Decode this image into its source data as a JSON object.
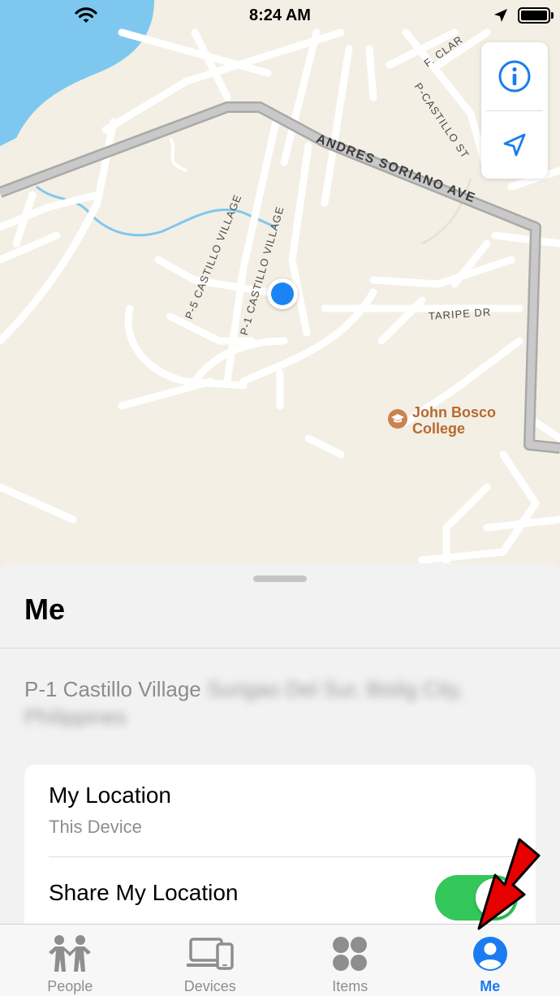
{
  "status_bar": {
    "time": "8:24 AM"
  },
  "map": {
    "streets": {
      "main": "ANDRES SORIANO AVE",
      "p5": "P-5 CASTILLO VILLAGE",
      "p1": "P-1 CASTILLO VILLAGE",
      "taripe": "TARIPE DR",
      "p_castillo_st": "P-CASTILLO ST",
      "f_clar": "F. CLAR"
    },
    "poi": {
      "name_line1": "John Bosco",
      "name_line2": "College"
    },
    "controls": {
      "info_icon": "info-icon",
      "locate_icon": "location-arrow-icon"
    }
  },
  "sheet": {
    "title": "Me",
    "address_visible": "P-1 Castillo Village",
    "address_blurred": "Surigao Del Sur, Bislig City, Philippines",
    "card": {
      "my_location_title": "My Location",
      "my_location_subtitle": "This Device",
      "share_title": "Share My Location",
      "share_enabled": true
    }
  },
  "tabs": [
    {
      "label": "People",
      "icon": "people-icon",
      "active": false
    },
    {
      "label": "Devices",
      "icon": "devices-icon",
      "active": false
    },
    {
      "label": "Items",
      "icon": "items-icon",
      "active": false
    },
    {
      "label": "Me",
      "icon": "person-circle-icon",
      "active": true
    }
  ],
  "colors": {
    "accent": "#1a7cf0",
    "toggle_on": "#34c759",
    "poi": "#b8692f",
    "annotation": "#e60000"
  }
}
